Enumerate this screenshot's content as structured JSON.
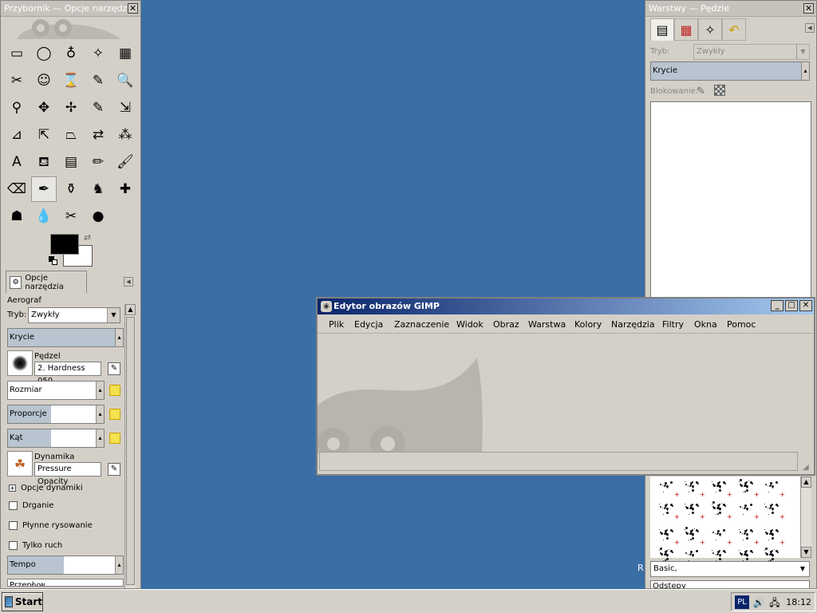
{
  "toolbox": {
    "title": "Przybornik — Opcje narzędzia",
    "close": "✕",
    "tool_icons": [
      "▭",
      "◯",
      "♁",
      "✧",
      "▦",
      "✂",
      "☺",
      "⌛",
      "✎",
      "🔍",
      "⚲",
      "✥",
      "✢",
      "✎",
      "⇲",
      "⊿",
      "⇱",
      "⏢",
      "⇄",
      "⁂",
      "A",
      "⛾",
      "▤",
      "✏",
      "🖌",
      "⌫",
      "✒",
      "⚱",
      "♞",
      "✚",
      "☗",
      "💧",
      "✂",
      "●"
    ],
    "tab_label": "Opcje narzędzia",
    "tool_name": "Aerograf",
    "mode_label": "Tryb:",
    "mode_value": "Zwykły",
    "opacity_label": "Krycie",
    "brush_label": "Pędzel",
    "brush_value": "2. Hardness 050",
    "size_label": "Rozmiar",
    "aspect_label": "Proporcje",
    "angle_label": "Kąt",
    "dynamics_label": "Dynamika",
    "dynamics_value": "Pressure Opacity",
    "dynamics_options_label": "Opcje dynamiki",
    "jitter_label": "Drganie",
    "smooth_label": "Płynne rysowanie",
    "motion_only_label": "Tylko ruch",
    "rate_label": "Tempo",
    "flow_label": "Przepływ"
  },
  "layers": {
    "title": "Warstwy — Pędzle",
    "close": "✕",
    "mode_label": "Tryb:",
    "mode_value": "Zwykły",
    "opacity_label": "Krycie",
    "lock_label": "Blokowanie:",
    "brush_tag": "Basic,",
    "spacing_label": "Odstępy"
  },
  "image_window": {
    "title": "Edytor obrazów GIMP",
    "menu": [
      "Plik",
      "Edycja",
      "Zaznaczenie",
      "Widok",
      "Obraz",
      "Warstwa",
      "Kolory",
      "Narzędzia",
      "Filtry",
      "Okna",
      "Pomoc"
    ],
    "minimize": "_",
    "maximize": "□",
    "close": "✕"
  },
  "desktop": {
    "stray_letter": "R"
  },
  "taskbar": {
    "start_label": "Start",
    "lang": "PL",
    "clock": "18:12"
  }
}
